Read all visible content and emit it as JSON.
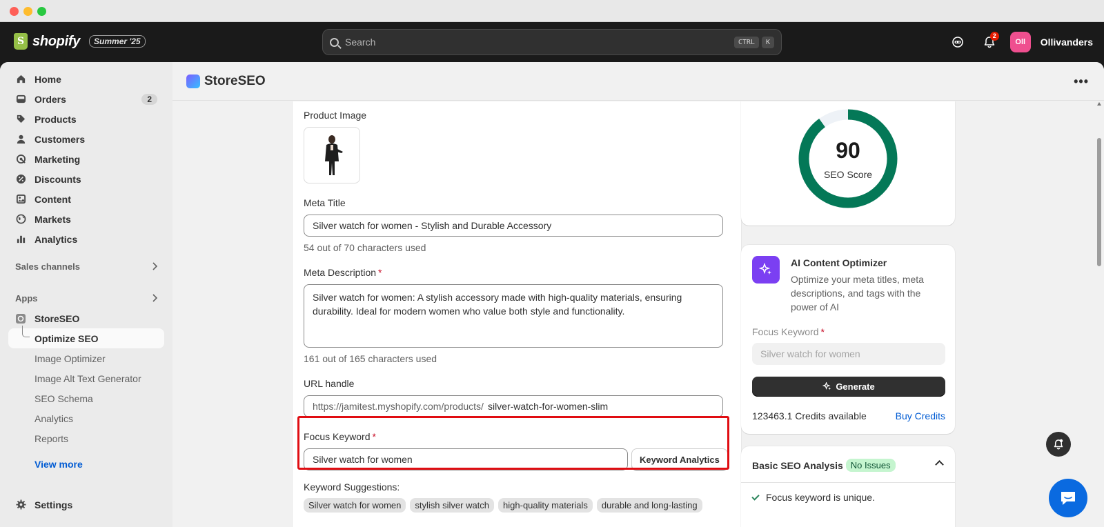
{
  "topbar": {
    "brand": "shopify",
    "edition": "Summer '25",
    "search_placeholder": "Search",
    "shortcut_keys": [
      "CTRL",
      "K"
    ],
    "notification_count": "2",
    "avatar_initials": "Oll",
    "store_name": "Ollivanders"
  },
  "sidebar": {
    "items": [
      {
        "label": "Home",
        "icon": "home-icon"
      },
      {
        "label": "Orders",
        "icon": "orders-icon",
        "badge": "2"
      },
      {
        "label": "Products",
        "icon": "tag-icon"
      },
      {
        "label": "Customers",
        "icon": "person-icon"
      },
      {
        "label": "Marketing",
        "icon": "target-icon"
      },
      {
        "label": "Discounts",
        "icon": "discount-icon"
      },
      {
        "label": "Content",
        "icon": "content-icon"
      },
      {
        "label": "Markets",
        "icon": "globe-icon"
      },
      {
        "label": "Analytics",
        "icon": "bar-chart-icon"
      }
    ],
    "sales_channels_label": "Sales channels",
    "apps_label": "Apps",
    "app_name": "StoreSEO",
    "app_subitems": [
      {
        "label": "Optimize SEO",
        "active": true
      },
      {
        "label": "Image Optimizer"
      },
      {
        "label": "Image Alt Text Generator"
      },
      {
        "label": "SEO Schema"
      },
      {
        "label": "Analytics"
      },
      {
        "label": "Reports"
      }
    ],
    "view_more": "View more",
    "settings": "Settings"
  },
  "app_header": {
    "title": "StoreSEO"
  },
  "form": {
    "product_image_label": "Product Image",
    "meta_title_label": "Meta Title",
    "meta_title_value": "Silver watch for women - Stylish and Durable Accessory",
    "meta_title_help": "54 out of 70 characters used",
    "meta_description_label": "Meta Description",
    "meta_description_value": "Silver watch for women: A stylish accessory made with high-quality materials, ensuring durability. Ideal for modern women who value both style and functionality.",
    "meta_description_help": "161 out of 165 characters used",
    "url_handle_label": "URL handle",
    "url_prefix": "https://jamitest.myshopify.com/products/",
    "url_handle_value": "silver-watch-for-women-slim",
    "focus_keyword_label": "Focus Keyword",
    "focus_keyword_value": "Silver watch for women",
    "keyword_analytics_button": "Keyword Analytics",
    "keyword_suggestions_label": "Keyword Suggestions:",
    "keyword_suggestions": [
      "Silver watch for women",
      "stylish silver watch",
      "high-quality materials",
      "durable and long-lasting"
    ]
  },
  "score": {
    "value": "90",
    "label": "SEO Score",
    "fraction": 0.9,
    "color": "#047857"
  },
  "ai_optimizer": {
    "title": "AI Content Optimizer",
    "description": "Optimize your meta titles, meta descriptions, and tags with the power of AI",
    "focus_keyword_label": "Focus Keyword",
    "focus_keyword_placeholder": "Silver watch for women",
    "generate_button": "Generate",
    "credits": "123463.1 Credits available",
    "buy_credits": "Buy Credits"
  },
  "basic_analysis": {
    "title": "Basic SEO Analysis",
    "badge": "No Issues",
    "items": [
      "Focus keyword is unique."
    ]
  }
}
